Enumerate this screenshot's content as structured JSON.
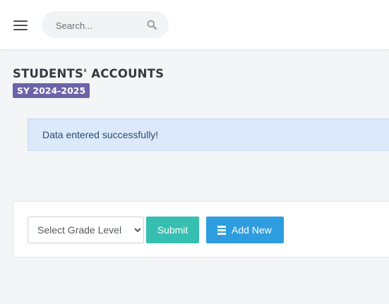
{
  "header": {
    "menu_icon": "hamburger-menu-icon",
    "search": {
      "placeholder": "Search...",
      "value": "",
      "icon": "search-icon"
    }
  },
  "page": {
    "title": "STUDENTS' ACCOUNTS",
    "school_year_badge": "SY 2024-2025"
  },
  "alert": {
    "message": "Data entered successfully!"
  },
  "filter": {
    "grade_select": {
      "selected": "Select Grade Level",
      "options": [
        "Select Grade Level"
      ]
    },
    "submit_label": "Submit",
    "add_new_label": "Add New",
    "add_new_icon": "list-icon"
  },
  "colors": {
    "badge": "#6c63a8",
    "alert_bg": "#dce9fb",
    "submit": "#36bfb1",
    "add_new": "#2e9ddf"
  }
}
